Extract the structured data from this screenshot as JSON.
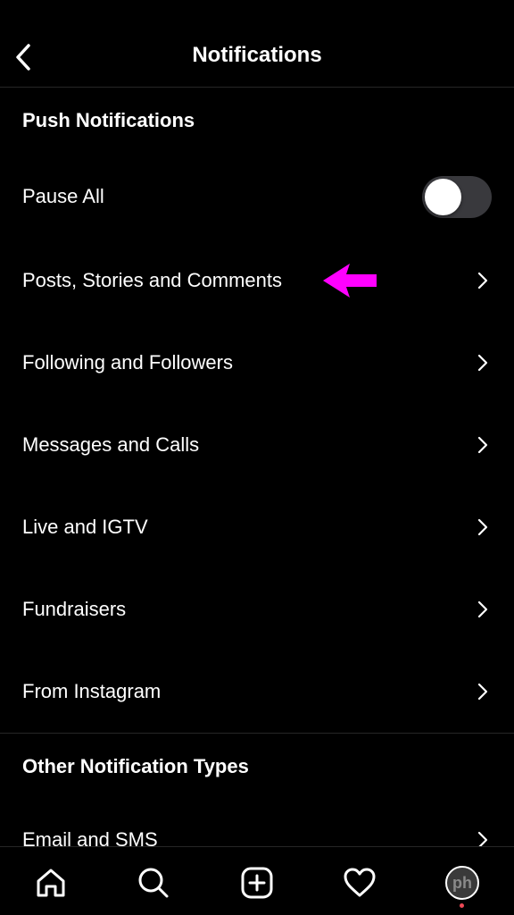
{
  "header": {
    "title": "Notifications"
  },
  "sections": {
    "push_title": "Push Notifications",
    "other_title": "Other Notification Types"
  },
  "pause_all": {
    "label": "Pause All",
    "enabled": false
  },
  "push_items": [
    {
      "label": "Posts, Stories and Comments"
    },
    {
      "label": "Following and Followers"
    },
    {
      "label": "Messages and Calls"
    },
    {
      "label": "Live and IGTV"
    },
    {
      "label": "Fundraisers"
    },
    {
      "label": "From Instagram"
    }
  ],
  "other_items": [
    {
      "label": "Email and SMS"
    }
  ],
  "tabbar": {
    "items": [
      "home-icon",
      "search-icon",
      "create-icon",
      "heart-icon",
      "profile-avatar"
    ],
    "avatar_text": "ph"
  },
  "colors": {
    "background": "#000000",
    "text": "#ffffff",
    "annotation_arrow": "#ff00ff",
    "toggle_off": "#39393d",
    "notification_dot": "#ed4956"
  }
}
